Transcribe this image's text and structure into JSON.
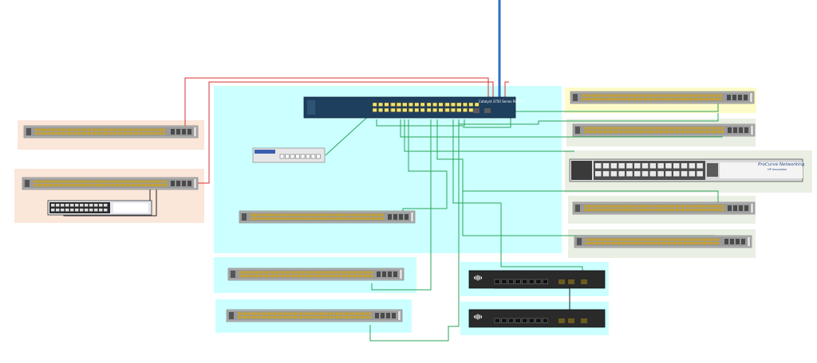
{
  "diagram": {
    "colors": {
      "zone_cyan": "#ccffff",
      "zone_peach": "#fbe6da",
      "zone_yellow": "#fdfbc8",
      "zone_sage": "#eaefe3",
      "link_green": "#2aa35a",
      "link_red": "#d93030",
      "uplink_blue": "#2f6fc9",
      "chassis_gray": "#8c8c8c",
      "port_amber": "#c9a227",
      "core_navy": "#1f3f5f"
    },
    "devices": {
      "core_switch": {
        "model_label": "Catalyst 3750 Series PoE-24"
      },
      "procurve_switch": {
        "brand_label": "ProCurve Networking",
        "sub_label": "HP Innovation"
      },
      "small_business_a": {
        "icon": "cisco-logo-icon"
      },
      "small_business_b": {
        "icon": "cisco-logo-icon"
      }
    }
  }
}
